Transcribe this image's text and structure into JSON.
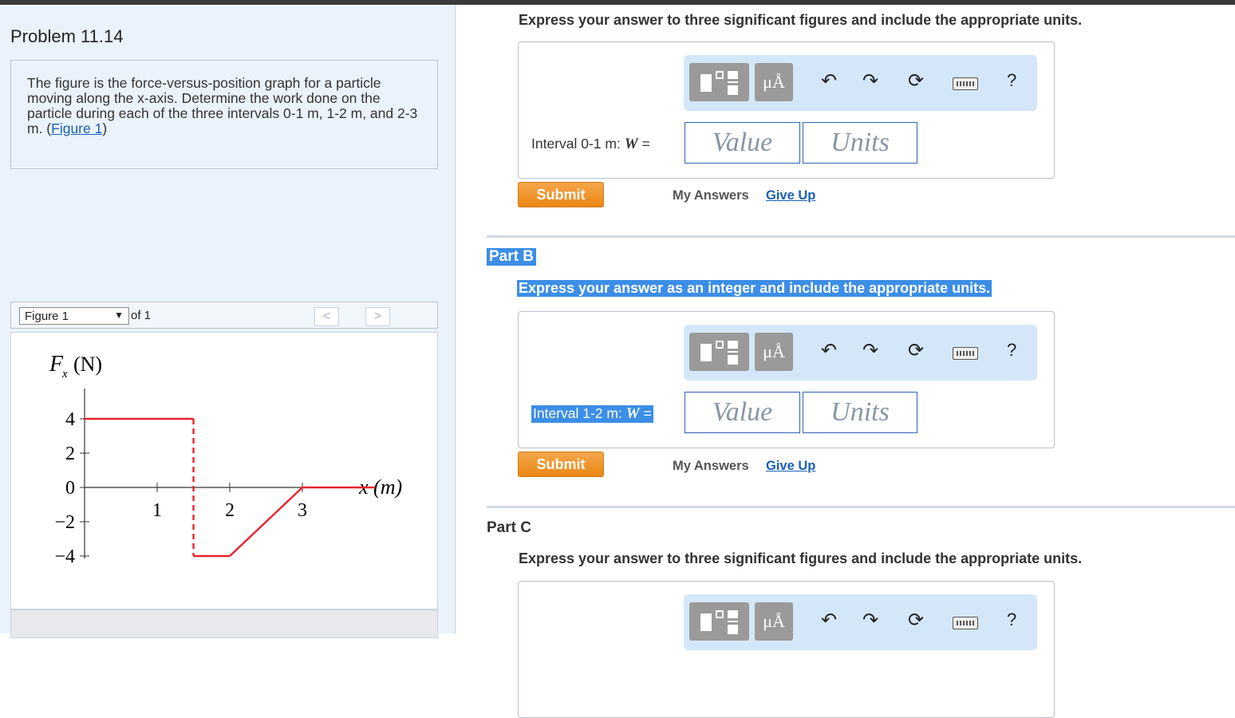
{
  "problem": {
    "title": "Problem 11.14",
    "text_before_link": "The figure is the force-versus-position graph for a particle moving along the x-axis. Determine the work done on the particle during each of the three intervals 0-1 m, 1-2 m, and 2-3 m. (",
    "link_text": "Figure 1",
    "text_after_link": ")"
  },
  "figure_nav": {
    "selected": "Figure 1",
    "of_text": "of 1",
    "prev_glyph": "<",
    "next_glyph": ">"
  },
  "figure": {
    "y_label_main": "F",
    "y_label_sub": "x",
    "y_label_unit": "(N)",
    "x_label": "x (m)",
    "y_ticks": [
      "4",
      "2",
      "0",
      "−2",
      "−4"
    ],
    "x_ticks": [
      "1",
      "2",
      "3"
    ],
    "colors": {
      "graph": "#e8232b",
      "axes": "#333333"
    }
  },
  "chart_data": {
    "type": "line",
    "x": [
      0,
      1.5,
      1.5,
      2.0,
      3.0,
      4.0
    ],
    "y": [
      4,
      4,
      -4,
      -4,
      0,
      0
    ],
    "xlabel": "x (m)",
    "ylabel": "Fx (N)",
    "xlim": [
      0,
      4
    ],
    "ylim": [
      -4,
      4
    ],
    "x_ticks": [
      1,
      2,
      3
    ],
    "y_ticks": [
      4,
      2,
      0,
      -2,
      -4
    ],
    "grid": false
  },
  "part_a": {
    "instruction": "Express your answer to three significant figures and include the appropriate units.",
    "label_prefix": "Interval 0-1 m: ",
    "label_var": "W",
    "label_suffix": " =",
    "value_placeholder": "Value",
    "units_placeholder": "Units",
    "submit": "Submit",
    "my_answers": "My Answers",
    "give_up": "Give Up"
  },
  "part_b": {
    "title": "Part B",
    "instruction": "Express your answer as an integer and include the appropriate units.",
    "label_prefix": "Interval 1-2 m: ",
    "label_var": "W",
    "label_suffix": " =",
    "value_placeholder": "Value",
    "units_placeholder": "Units",
    "submit": "Submit",
    "my_answers": "My Answers",
    "give_up": "Give Up"
  },
  "part_c": {
    "title": "Part C",
    "instruction": "Express your answer to three significant figures and include the appropriate units."
  },
  "toolbar": {
    "mu_label": "μÅ",
    "undo": "↶",
    "redo": "↷",
    "reset": "⟳",
    "help": "?"
  }
}
